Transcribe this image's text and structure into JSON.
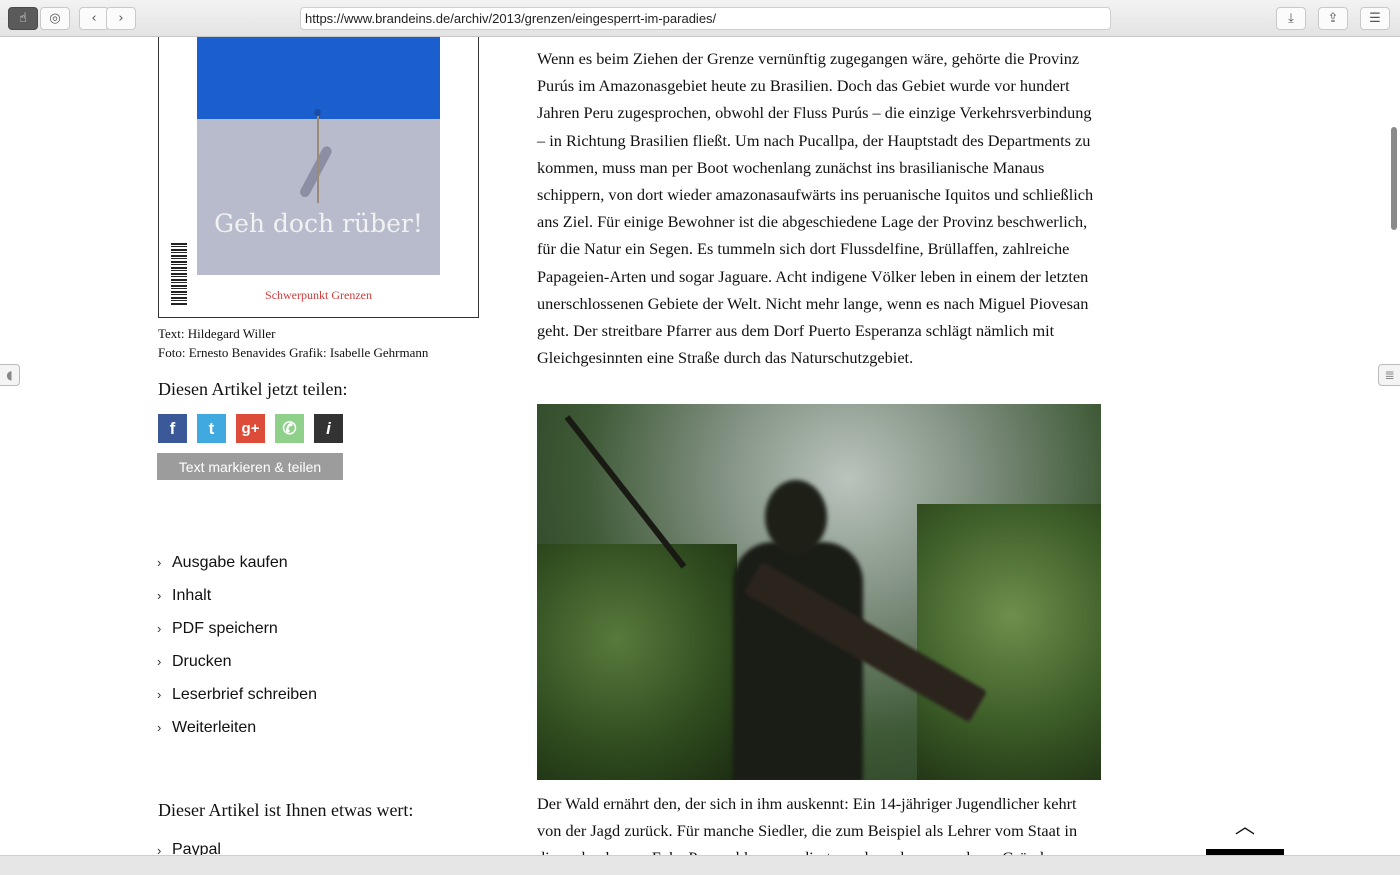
{
  "browser": {
    "url": "https://www.brandeins.de/archiv/2013/grenzen/eingesperrt-im-paradies/",
    "icons": [
      "pointer-icon",
      "screenshot-icon",
      "back-icon",
      "forward-icon",
      "download-icon",
      "share-icon",
      "reading-list-icon"
    ]
  },
  "cover": {
    "title": "Geh doch rüber!",
    "subtitle": "Schwerpunkt Grenzen",
    "colors": {
      "blue": "#1b5fcf",
      "gray": "#b7bbcb",
      "subtitle": "#d23a3a"
    }
  },
  "credits": {
    "text": "Text: Hildegard Willer",
    "photo": "Foto: Ernesto Benavides Grafik: Isabelle Gehrmann"
  },
  "share": {
    "heading": "Diesen Artikel jetzt teilen:",
    "icons": [
      {
        "name": "facebook-icon",
        "glyph": "f",
        "color": "#3b5998"
      },
      {
        "name": "twitter-icon",
        "glyph": "t",
        "color": "#3fa9e0"
      },
      {
        "name": "google-plus-icon",
        "glyph": "g+",
        "color": "#dd4b39"
      },
      {
        "name": "whatsapp-icon",
        "glyph": "✆",
        "color": "#8fd08a"
      },
      {
        "name": "info-icon",
        "glyph": "i",
        "color": "#333333"
      }
    ],
    "mark_button": "Text markieren & teilen"
  },
  "menu": {
    "items": [
      "Ausgabe kaufen",
      "Inhalt",
      "PDF speichern",
      "Drucken",
      "Leserbrief schreiben",
      "Weiterleiten"
    ]
  },
  "worth": {
    "heading": "Dieser Artikel ist Ihnen etwas wert:",
    "paypal": "Paypal"
  },
  "article": {
    "paragraph1": "Wenn es beim Ziehen der Grenze vernünftig zugegangen wäre, gehörte die Provinz Purús im Amazonasgebiet heute zu Brasilien. Doch das Gebiet wurde vor hundert Jahren Peru zugesprochen, obwohl der Fluss Purús – die einzige Verkehrsverbindung – in Richtung Brasilien fließt. Um nach Pucallpa, der Hauptstadt des Departments zu kommen, muss man per Boot wochenlang zunächst ins brasilianische Manaus schippern, von dort wieder amazonasaufwärts ins peruanische Iquitos und schließlich ans Ziel. Für einige Bewohner ist die abgeschiedene Lage der Provinz beschwerlich, für die Natur ein Segen. Es tummeln sich dort Flussdelfine, Brüllaffen, zahlreiche Papageien-Arten und sogar Jaguare. Acht indigene Völker leben in einem der letzten unerschlossenen Gebiete der Welt. Nicht mehr lange, wenn es nach Miguel Piovesan geht. Der streitbare Pfarrer aus dem Dorf Puerto Esperanza schlägt nämlich mit Gleichgesinnten eine Straße durch das Naturschutzgebiet.",
    "caption_line1": "Der Wald ernährt den, der sich in ihm auskennt: Ein 14-jähriger Jugendlicher kehrt",
    "caption_line2": "von der Jagd zurück. Für manche Siedler, die zum Beispiel als Lehrer vom Staat in",
    "caption_line3": "diese abgelegene Ecke Perus abkommandiert wurden oder aus anderen Gründen"
  }
}
